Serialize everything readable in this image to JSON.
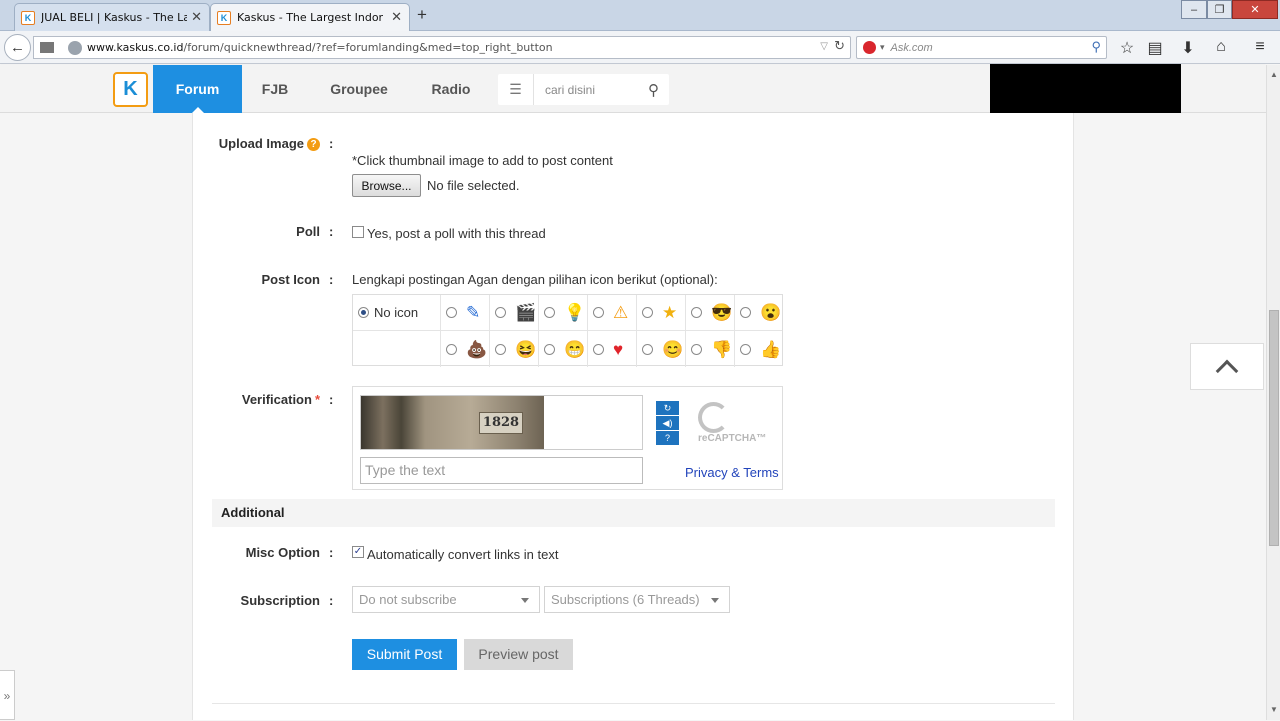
{
  "browser": {
    "tabs": [
      {
        "title": "JUAL BELI | Kaskus - The La...",
        "active": false
      },
      {
        "title": "Kaskus - The Largest Indon...",
        "active": true
      }
    ],
    "url_host": "www.kaskus.co.id",
    "url_path": "/forum/quicknewthread/?ref=forumlanding&med=top_right_button",
    "search_engine_placeholder": "Ask.com"
  },
  "site": {
    "logo_letter": "K",
    "nav": [
      {
        "label": "Forum",
        "active": true
      },
      {
        "label": "FJB",
        "active": false
      },
      {
        "label": "Groupee",
        "active": false
      },
      {
        "label": "Radio",
        "active": false
      }
    ],
    "search_placeholder": "cari disini",
    "accent": "#1e8fe1"
  },
  "form": {
    "upload": {
      "label": "Upload Image",
      "hint": "*Click thumbnail image to add to post content",
      "browse_label": "Browse...",
      "file_status": "No file selected."
    },
    "poll": {
      "label": "Poll",
      "option": "Yes, post a poll with this thread",
      "checked": false
    },
    "post_icon": {
      "label": "Post Icon",
      "intro": "Lengkapi postingan Agan dengan pilihan icon berikut (optional):",
      "no_icon_label": "No icon",
      "selected": "No icon",
      "row1_icons": [
        "pencil-icon",
        "clapperboard-icon",
        "lightbulb-icon",
        "warning-icon",
        "star-icon",
        "cool-face-icon",
        "shock-face-icon"
      ],
      "row2_icons": [
        "poop-icon",
        "laugh-face-icon",
        "grin-face-icon",
        "heart-icon",
        "smile-face-icon",
        "thumbs-down-icon",
        "thumbs-up-icon"
      ]
    },
    "verification": {
      "label": "Verification",
      "required_mark": "*",
      "captcha_number": "1828",
      "input_placeholder": "Type the text",
      "privacy_terms": "Privacy & Terms",
      "recaptcha_brand": "reCAPTCHA™"
    },
    "additional": {
      "heading": "Additional"
    },
    "misc": {
      "label": "Misc Option",
      "option": "Automatically convert links in text",
      "checked": true
    },
    "subscription": {
      "label": "Subscription",
      "select1": "Do not subscribe",
      "select2": "Subscriptions (6 Threads)"
    },
    "buttons": {
      "submit": "Submit Post",
      "preview": "Preview post"
    },
    "colon": ":"
  }
}
